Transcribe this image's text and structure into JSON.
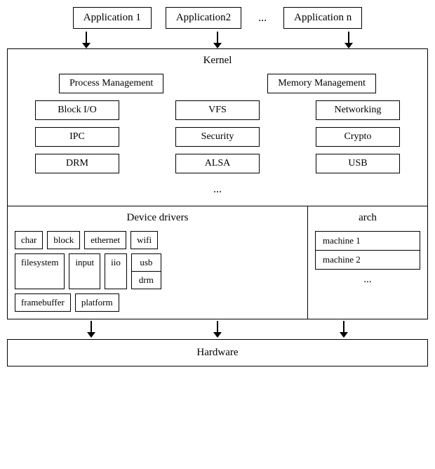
{
  "apps": {
    "app1_label": "Application 1",
    "app2_label": "Application2",
    "ellipsis": "...",
    "appn_label": "Application n"
  },
  "kernel": {
    "label": "Kernel",
    "items": {
      "process_management": "Process Management",
      "memory_management": "Memory Management",
      "block_io": "Block I/O",
      "vfs": "VFS",
      "networking": "Networking",
      "ipc": "IPC",
      "security": "Security",
      "crypto": "Crypto",
      "drm": "DRM",
      "alsa": "ALSA",
      "usb": "USB",
      "dots": "..."
    }
  },
  "device_drivers": {
    "label": "Device drivers",
    "items": {
      "char": "char",
      "block": "block",
      "ethernet": "ethernet",
      "wifi": "wifi",
      "filesystem": "filesystem",
      "input": "input",
      "iio": "iio",
      "usb": "usb",
      "drm": "drm",
      "framebuffer": "framebuffer",
      "platform": "platform"
    }
  },
  "arch": {
    "label": "arch",
    "machine1": "machine 1",
    "machine2": "machine 2",
    "dots": "..."
  },
  "hardware": {
    "label": "Hardware"
  }
}
